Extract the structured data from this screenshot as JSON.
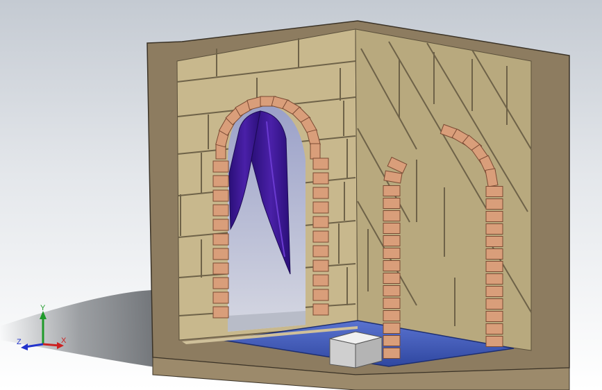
{
  "viewport": {
    "colors": {
      "background_top": "#c4cad2",
      "background_bottom": "#ffffff",
      "wall_section": "#8f7e62",
      "stone_wall": "#c9b98e",
      "stone_wall_side": "#b3a47b",
      "mortar_lines": "#6e6248",
      "arch_brick": "#d99e7a",
      "arch_brick_edge": "#7a4a33",
      "curtain": "#3b168f",
      "curtain_light": "#5a2cc0",
      "water": "#3f58b8",
      "floor_block": "#d8d8d8"
    }
  },
  "triad": {
    "icon": "view-orientation-triad-icon",
    "x_label": "X",
    "y_label": "Y",
    "z_label": "Z",
    "x_color": "#cc2222",
    "y_color": "#1f9a2a",
    "z_color": "#2233cc"
  }
}
